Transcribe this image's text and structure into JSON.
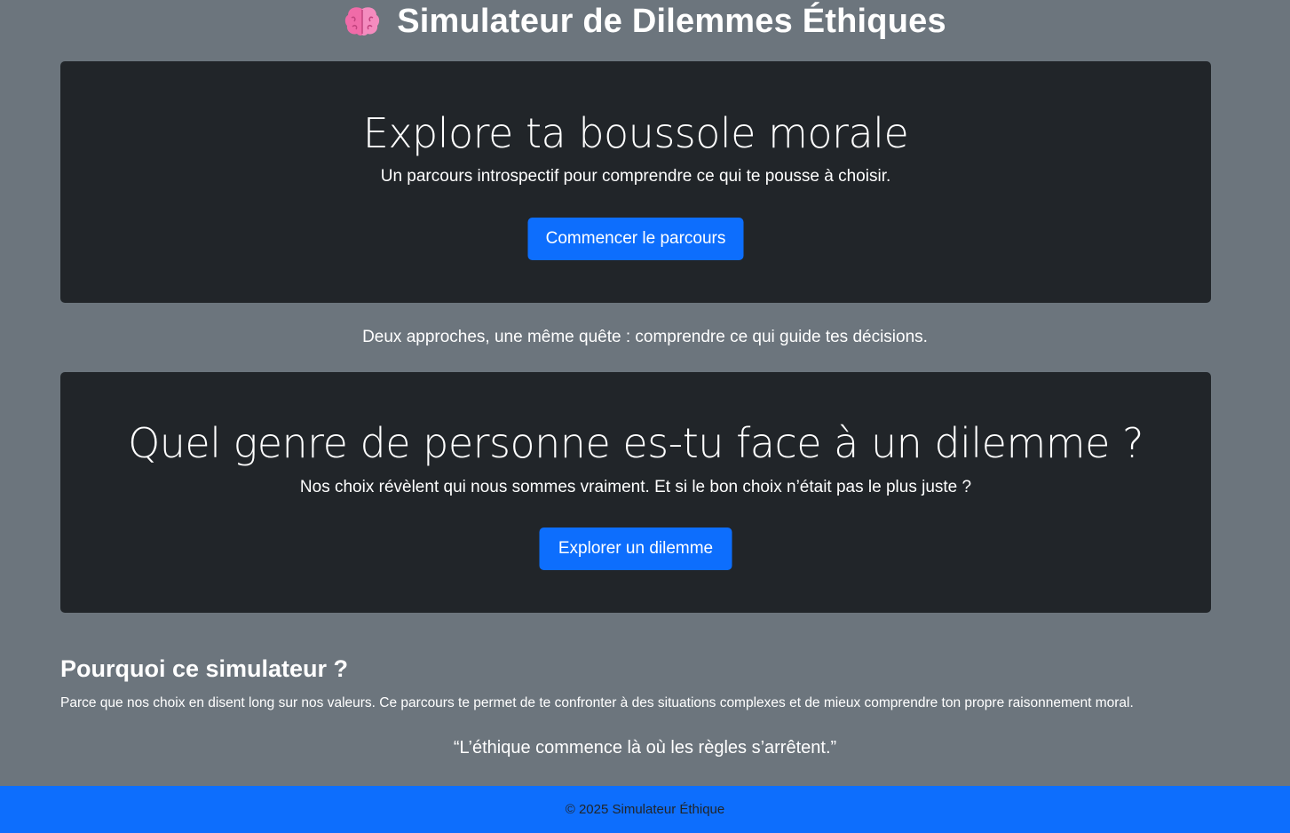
{
  "header": {
    "icon": "brain-icon",
    "title": "Simulateur de Dilemmes Éthiques"
  },
  "hero": {
    "heading": "Explore ta boussole morale",
    "subtitle": "Un parcours introspectif pour comprendre ce qui te pousse à choisir.",
    "button_label": "Commencer le parcours"
  },
  "tagline": "Deux approches, une même quête : comprendre ce qui guide tes décisions.",
  "dilemma": {
    "heading": "Quel genre de personne es-tu face à un dilemme ?",
    "subtitle": "Nos choix révèlent qui nous sommes vraiment. Et si le bon choix n’était pas le plus juste ?",
    "button_label": "Explorer un dilemme"
  },
  "why": {
    "title": "Pourquoi ce simulateur ?",
    "text": "Parce que nos choix en disent long sur nos valeurs. Ce parcours te permet de te confronter à des situations complexes et de mieux comprendre ton propre raisonnement moral."
  },
  "quote": "“L’éthique commence là où les règles s’arrêtent.”",
  "footer": {
    "text": "© 2025 Simulateur Éthique"
  },
  "colors": {
    "background": "#6c757d",
    "card": "#212529",
    "primary": "#0d6efd",
    "brain": "#f06ba8"
  }
}
